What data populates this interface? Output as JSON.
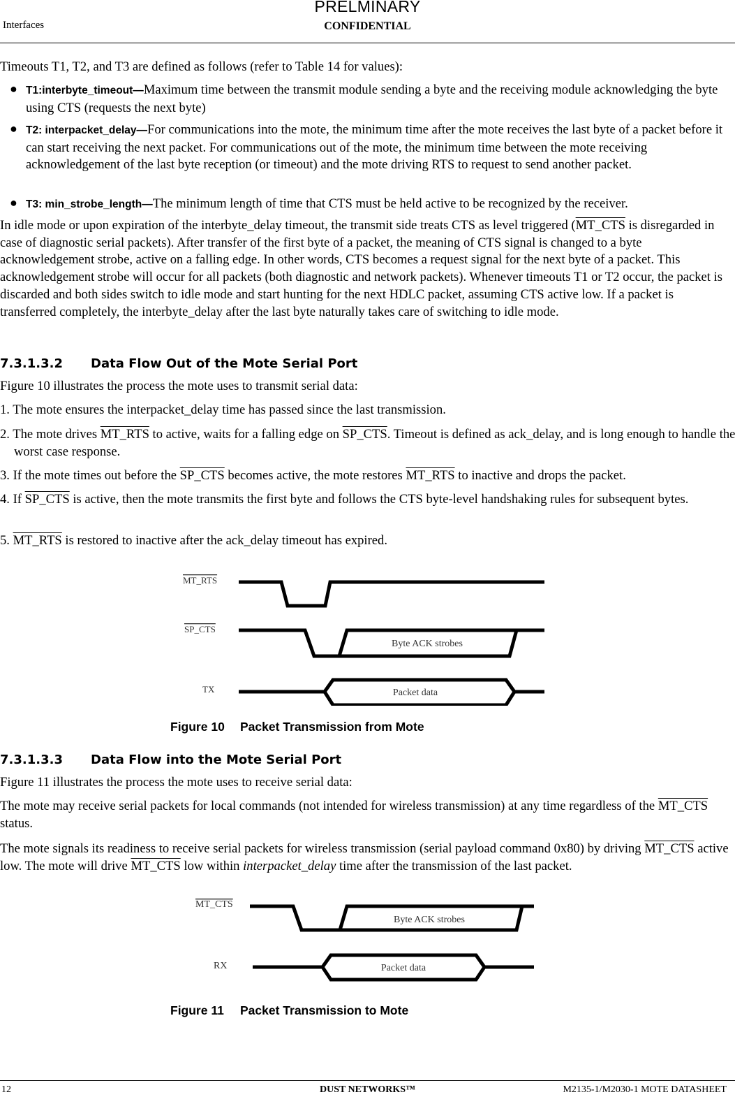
{
  "header": {
    "watermark": "PRELMINARY",
    "section": "Interfaces",
    "classification": "CONFIDENTIAL"
  },
  "intro": "Timeouts T1, T2, and T3 are defined as follows (refer to Table 14 for values):",
  "timeouts": [
    {
      "term": "T1:interbyte_timeout—",
      "text": "Maximum time between the transmit module sending a byte and the receiving module acknowledging the byte using CTS (requests the next byte)"
    },
    {
      "term": "T2: interpacket_delay—",
      "text": "For communications into the mote, the minimum time after the mote receives the last byte of a packet before it can start receiving the next packet. For communications out of the mote, the minimum time between the mote receiving acknowledgement of the last byte reception (or timeout) and the mote driving RTS to request to send another packet."
    },
    {
      "term": "T3: min_strobe_length—",
      "text": "The minimum length of time that CTS must be held active to be recognized by the receiver."
    }
  ],
  "idle_paragraph": {
    "before": "In idle mode or upon expiration of the interbyte_delay timeout, the transmit side treats CTS as level triggered (",
    "signal": "MT_CTS",
    "after": " is disregarded in case of diagnostic serial packets). After transfer of the first byte of a packet, the meaning of CTS signal is changed to a byte acknowledgement strobe, active on a falling edge. In other words, CTS becomes a request signal for the next byte of a packet. This acknowledgement strobe will occur for all packets (both diagnostic and network packets). Whenever timeouts T1 or T2 occur, the packet is discarded and both sides switch to idle mode and start hunting for the next HDLC packet, assuming CTS active low. If a packet is transferred completely, the interbyte_delay after the last byte naturally takes care of switching to idle mode."
  },
  "section_out": {
    "number": "7.3.1.3.2",
    "title": "Data Flow Out of the Mote Serial Port",
    "lead": "Figure 10 illustrates the process the mote uses to transmit serial data:",
    "steps": [
      {
        "parts": [
          {
            "t": "1. The mote ensures the interpacket_delay time has passed since the last transmission."
          }
        ]
      },
      {
        "parts": [
          {
            "t": "2. The mote drives "
          },
          {
            "t": "MT_RTS",
            "ov": true
          },
          {
            "t": " to active, waits for a falling edge on "
          },
          {
            "t": "SP_CTS",
            "ov": true
          },
          {
            "t": ". Timeout is defined as ack_delay, and is long enough to handle the worst case response."
          }
        ]
      },
      {
        "parts": [
          {
            "t": "3. If the mote times out before the "
          },
          {
            "t": "SP_CTS",
            "ov": true
          },
          {
            "t": " becomes active, the mote restores "
          },
          {
            "t": "MT_RTS",
            "ov": true
          },
          {
            "t": " to inactive and drops the packet."
          }
        ]
      },
      {
        "parts": [
          {
            "t": "4. If "
          },
          {
            "t": "SP_CTS",
            "ov": true
          },
          {
            "t": " is active, then the mote transmits the first byte and follows the CTS byte-level handshaking rules for subsequent bytes."
          }
        ]
      },
      {
        "parts": [
          {
            "t": "5. "
          },
          {
            "t": "MT_RTS",
            "ov": true
          },
          {
            "t": " is restored to inactive after the ack_delay timeout has expired."
          }
        ]
      }
    ]
  },
  "figure10": {
    "number": "Figure 10",
    "title": "Packet Transmission from Mote",
    "signals": [
      "MT_RTS",
      "SP_CTS",
      "TX"
    ],
    "strobe_label": "Byte ACK strobes",
    "data_label": "Packet data"
  },
  "section_in": {
    "number": "7.3.1.3.3",
    "title": "Data Flow into the Mote Serial Port",
    "lead": "Figure 11 illustrates the process the mote uses to receive serial data:",
    "para1_before": "The mote may receive serial packets for local commands (not intended for wireless transmission) at any time regardless of the ",
    "para1_signal": "MT_CTS",
    "para1_after": " status.",
    "para2_a": "The mote signals its readiness to receive serial packets for wireless transmission (serial payload command 0x80) by driving ",
    "para2_signal1": "MT_CTS",
    "para2_b": " active low. The mote will drive ",
    "para2_signal2": "MT_CTS",
    "para2_c": " low within ",
    "para2_italic": "interpacket_delay",
    "para2_d": " time after the transmission of the last packet."
  },
  "figure11": {
    "number": "Figure 11",
    "title": "Packet Transmission to Mote",
    "signals": [
      "MT_CTS",
      "RX"
    ],
    "strobe_label": "Byte ACK strobes",
    "data_label": "Packet data"
  },
  "footer": {
    "page_number": "12",
    "company": "DUST NETWORKS™",
    "document": "M2135-1/M2030-1 MOTE DATASHEET"
  }
}
